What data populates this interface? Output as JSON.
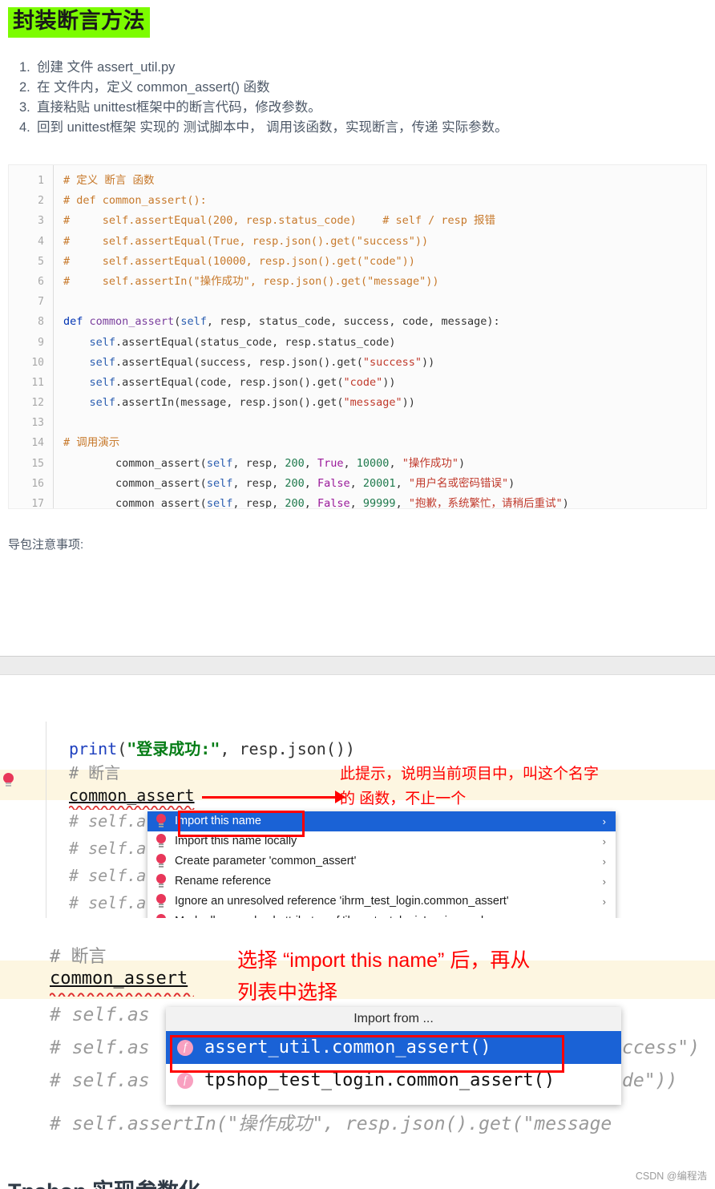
{
  "page_title": "封装断言方法",
  "title_highlight_color": "#7CFC00",
  "steps": [
    {
      "num": "1.",
      "text": "创建 文件 assert_util.py"
    },
    {
      "num": "2.",
      "text": "在 文件内，定义 common_assert() 函数"
    },
    {
      "num": "3.",
      "text": "直接粘贴 unittest框架中的断言代码，修改参数。"
    },
    {
      "num": "4.",
      "text": "回到 unittest框架 实现的 测试脚本中， 调用该函数，实现断言，传递 实际参数。"
    }
  ],
  "code_block": {
    "lines": [
      {
        "n": "1",
        "tokens": [
          {
            "t": "# 定义 断言 函数",
            "c": "c-com"
          }
        ]
      },
      {
        "n": "2",
        "tokens": [
          {
            "t": "# def common_assert():",
            "c": "c-com"
          }
        ]
      },
      {
        "n": "3",
        "tokens": [
          {
            "t": "#     self.assertEqual(200, resp.status_code)    # self / resp 报错",
            "c": "c-com"
          }
        ]
      },
      {
        "n": "4",
        "tokens": [
          {
            "t": "#     self.assertEqual(True, resp.json().get(\"success\"))",
            "c": "c-com"
          }
        ]
      },
      {
        "n": "5",
        "tokens": [
          {
            "t": "#     self.assertEqual(10000, resp.json().get(\"code\"))",
            "c": "c-com"
          }
        ]
      },
      {
        "n": "6",
        "tokens": [
          {
            "t": "#     self.assertIn(\"操作成功\", resp.json().get(\"message\"))",
            "c": "c-com"
          }
        ]
      },
      {
        "n": "7",
        "tokens": []
      },
      {
        "n": "8",
        "tokens": [
          {
            "t": "def ",
            "c": "c-def"
          },
          {
            "t": "common_assert",
            "c": "c-fn"
          },
          {
            "t": "(",
            "c": "c-plain"
          },
          {
            "t": "self",
            "c": "c-self"
          },
          {
            "t": ", resp, status_code, success, code, message):",
            "c": "c-plain"
          }
        ]
      },
      {
        "n": "9",
        "tokens": [
          {
            "t": "    ",
            "c": "c-plain"
          },
          {
            "t": "self",
            "c": "c-self"
          },
          {
            "t": ".assertEqual(status_code, resp.status_code)",
            "c": "c-plain"
          }
        ]
      },
      {
        "n": "10",
        "tokens": [
          {
            "t": "    ",
            "c": "c-plain"
          },
          {
            "t": "self",
            "c": "c-self"
          },
          {
            "t": ".assertEqual(success, resp.json().get(",
            "c": "c-plain"
          },
          {
            "t": "\"success\"",
            "c": "c-str"
          },
          {
            "t": "))",
            "c": "c-plain"
          }
        ]
      },
      {
        "n": "11",
        "tokens": [
          {
            "t": "    ",
            "c": "c-plain"
          },
          {
            "t": "self",
            "c": "c-self"
          },
          {
            "t": ".assertEqual(code, resp.json().get(",
            "c": "c-plain"
          },
          {
            "t": "\"code\"",
            "c": "c-str"
          },
          {
            "t": "))",
            "c": "c-plain"
          }
        ]
      },
      {
        "n": "12",
        "tokens": [
          {
            "t": "    ",
            "c": "c-plain"
          },
          {
            "t": "self",
            "c": "c-self"
          },
          {
            "t": ".assertIn(message, resp.json().get(",
            "c": "c-plain"
          },
          {
            "t": "\"message\"",
            "c": "c-str"
          },
          {
            "t": "))",
            "c": "c-plain"
          }
        ]
      },
      {
        "n": "13",
        "tokens": []
      },
      {
        "n": "14",
        "tokens": [
          {
            "t": "# 调用演示",
            "c": "c-com"
          }
        ]
      },
      {
        "n": "15",
        "tokens": [
          {
            "t": "        common_assert(",
            "c": "c-plain"
          },
          {
            "t": "self",
            "c": "c-self"
          },
          {
            "t": ", resp, ",
            "c": "c-plain"
          },
          {
            "t": "200",
            "c": "c-num"
          },
          {
            "t": ", ",
            "c": "c-plain"
          },
          {
            "t": "True",
            "c": "c-bool"
          },
          {
            "t": ", ",
            "c": "c-plain"
          },
          {
            "t": "10000",
            "c": "c-num"
          },
          {
            "t": ", ",
            "c": "c-plain"
          },
          {
            "t": "\"操作成功\"",
            "c": "c-str"
          },
          {
            "t": ")",
            "c": "c-plain"
          }
        ]
      },
      {
        "n": "16",
        "tokens": [
          {
            "t": "        common_assert(",
            "c": "c-plain"
          },
          {
            "t": "self",
            "c": "c-self"
          },
          {
            "t": ", resp, ",
            "c": "c-plain"
          },
          {
            "t": "200",
            "c": "c-num"
          },
          {
            "t": ", ",
            "c": "c-plain"
          },
          {
            "t": "False",
            "c": "c-bool"
          },
          {
            "t": ", ",
            "c": "c-plain"
          },
          {
            "t": "20001",
            "c": "c-num"
          },
          {
            "t": ", ",
            "c": "c-plain"
          },
          {
            "t": "\"用户名或密码错误\"",
            "c": "c-str"
          },
          {
            "t": ")",
            "c": "c-plain"
          }
        ]
      },
      {
        "n": "17",
        "tokens": [
          {
            "t": "        common_assert(",
            "c": "c-plain"
          },
          {
            "t": "self",
            "c": "c-self"
          },
          {
            "t": ", resp, ",
            "c": "c-plain"
          },
          {
            "t": "200",
            "c": "c-num"
          },
          {
            "t": ", ",
            "c": "c-plain"
          },
          {
            "t": "False",
            "c": "c-bool"
          },
          {
            "t": ", ",
            "c": "c-plain"
          },
          {
            "t": "99999",
            "c": "c-num"
          },
          {
            "t": ", ",
            "c": "c-plain"
          },
          {
            "t": "\"抱歉，系统繁忙，请稍后重试\"",
            "c": "c-str"
          },
          {
            "t": ")",
            "c": "c-plain"
          }
        ]
      }
    ]
  },
  "note_text": "导包注意事项:",
  "ide1": {
    "code_lines": [
      "print(\"登录成功:\", resp.json())",
      "# 断言",
      "common_assert",
      "# self.a",
      "# self.a",
      "# self.a",
      "# self.a"
    ],
    "print_kw": "print",
    "print_str": "\"登录成功:\"",
    "print_rest": ", resp.json())",
    "comment_duanyan": "# 断言",
    "symbol": "common_assert",
    "annotation_line1": "此提示，说明当前项目中，叫这个名字",
    "annotation_line2": "的 函数，不止一个",
    "menu_items": [
      {
        "label": "Import this name",
        "chevron": "›",
        "selected": true
      },
      {
        "label": "Import this name locally",
        "chevron": "›",
        "selected": false
      },
      {
        "label": "Create parameter 'common_assert'",
        "chevron": "›",
        "selected": false
      },
      {
        "label": "Rename reference",
        "chevron": "›",
        "selected": false
      },
      {
        "label": "Ignore an unresolved reference 'ihrm_test_login.common_assert'",
        "chevron": "›",
        "selected": false
      },
      {
        "label": "Mark all unresolved attributes of 'ihrm_test_login' as ignored",
        "chevron": "›",
        "selected": false
      }
    ]
  },
  "ide2": {
    "comment_duanyan": "# 断言",
    "symbol": "common_assert",
    "annotation_line1": "选择 “import this name” 后，再从",
    "annotation_line2": "列表中选择",
    "bg_code_lines": [
      "# self.as",
      "# self.as",
      "# self.as",
      "# self.assertIn(\"操作成功\", resp.json().get(\"message"
    ],
    "bg_right_1": "ccess\")",
    "bg_right_2": "de\"))",
    "popup_title": "Import from ...",
    "popup_items": [
      {
        "label": "assert_util.common_assert()",
        "icon": "f",
        "selected": true
      },
      {
        "label": "tpshop_test_login.common_assert()",
        "icon": "f",
        "selected": false
      }
    ]
  },
  "watermark": "CSDN @编程浩",
  "bottom_heading": "Tpshop 实现参数化",
  "colors": {
    "annotation_red": "#FF0000",
    "menu_selected_blue": "#1a62d6",
    "highlight_line": "#fdf6e1",
    "title_highlight": "#7CFC00"
  }
}
